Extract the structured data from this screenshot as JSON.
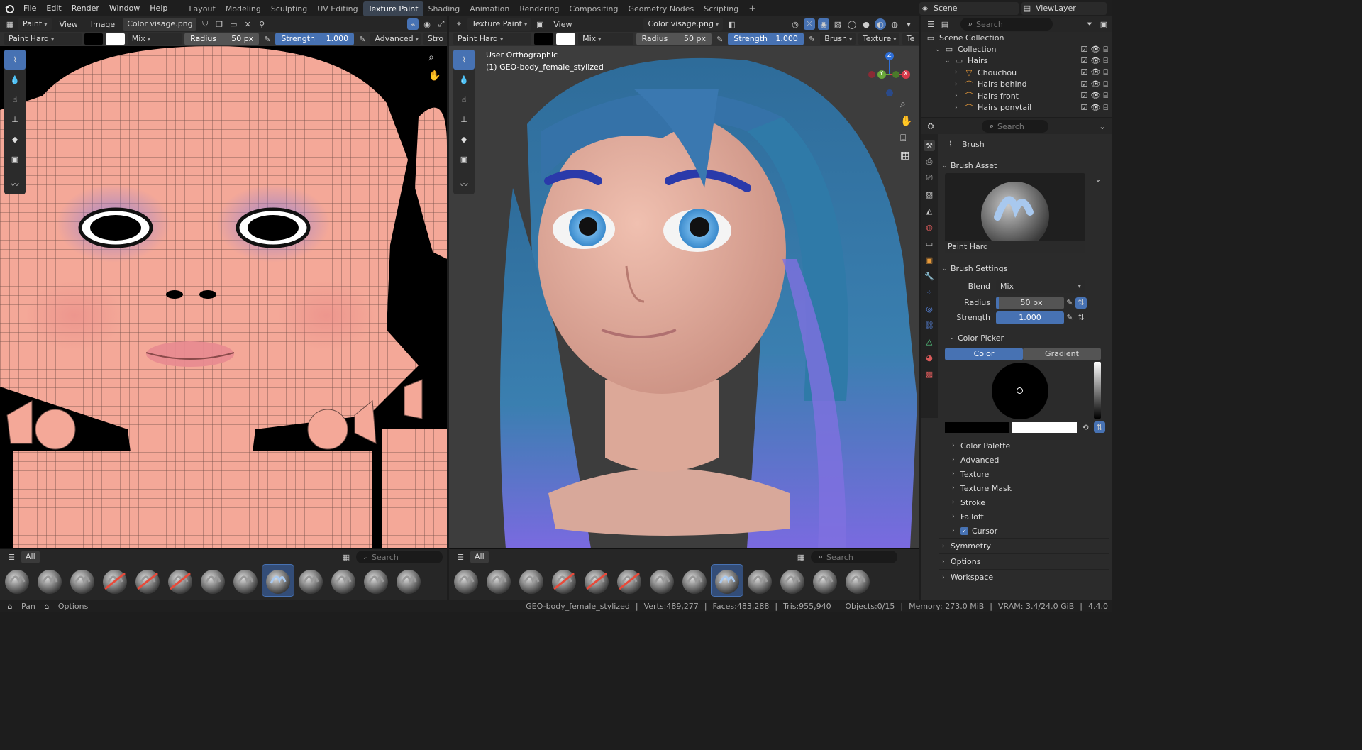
{
  "topbar": {
    "menus": [
      "File",
      "Edit",
      "Render",
      "Window",
      "Help"
    ],
    "workspaces": [
      "Layout",
      "Modeling",
      "Sculpting",
      "UV Editing",
      "Texture Paint",
      "Shading",
      "Animation",
      "Rendering",
      "Compositing",
      "Geometry Nodes",
      "Scripting"
    ],
    "active_workspace": "Texture Paint",
    "scene": "Scene",
    "view_layer": "ViewLayer"
  },
  "uv_editor": {
    "mode": "Paint",
    "menus": [
      "View",
      "Image"
    ],
    "image_name": "Color visage.png",
    "brush": "Paint Hard",
    "blend": "Mix",
    "radius_label": "Radius",
    "radius_value": "50 px",
    "strength_label": "Strength",
    "strength_value": "1.000",
    "advanced": "Advanced",
    "stroke_cut": "Stro"
  },
  "viewport": {
    "mode": "Texture Paint",
    "view_menu": "View",
    "image_name": "Color visage.png",
    "brush": "Paint Hard",
    "blend": "Mix",
    "radius_label": "Radius",
    "radius_value": "50 px",
    "strength_label": "Strength",
    "strength_value": "1.000",
    "brush_menu": "Brush",
    "texture_menu": "Texture",
    "tex_cut": "Te",
    "overlay_line1": "User Orthographic",
    "overlay_line2": "(1) GEO-body_female_stylized",
    "gizmo": {
      "x": "X",
      "y": "Y",
      "z": "Z"
    }
  },
  "shelf": {
    "tab_all": "All",
    "search_placeholder": "Search"
  },
  "outliner": {
    "search_placeholder": "Search",
    "items": [
      {
        "label": "Scene Collection",
        "indent": 0
      },
      {
        "label": "Collection",
        "indent": 1
      },
      {
        "label": "Hairs",
        "indent": 2
      },
      {
        "label": "Chouchou",
        "indent": 3
      },
      {
        "label": "Hairs behind",
        "indent": 3
      },
      {
        "label": "Hairs front",
        "indent": 3
      },
      {
        "label": "Hairs ponytail",
        "indent": 3
      }
    ]
  },
  "properties": {
    "search_placeholder": "Search",
    "title": "Brush",
    "brush_asset": "Brush Asset",
    "asset_name": "Paint Hard",
    "brush_settings": "Brush Settings",
    "blend_label": "Blend",
    "blend_value": "Mix",
    "radius_label": "Radius",
    "radius_value": "50 px",
    "strength_label": "Strength",
    "strength_value": "1.000",
    "color_picker": "Color Picker",
    "tab_color": "Color",
    "tab_gradient": "Gradient",
    "subpanels": [
      "Color Palette",
      "Advanced",
      "Texture",
      "Texture Mask",
      "Stroke",
      "Falloff",
      "Cursor"
    ],
    "panels": [
      "Symmetry",
      "Options",
      "Workspace"
    ]
  },
  "status": {
    "pan": "Pan",
    "options": "Options",
    "object": "GEO-body_female_stylized",
    "verts": "Verts:489,277",
    "faces": "Faces:483,288",
    "tris": "Tris:955,940",
    "objects": "Objects:0/15",
    "memory": "Memory: 273.0 MiB",
    "vram": "VRAM: 3.4/24.0 GiB",
    "version": "4.4.0"
  },
  "colors": {
    "accent": "#4772b3",
    "skin": "#f4a898",
    "hair": "#3a7fb0"
  }
}
